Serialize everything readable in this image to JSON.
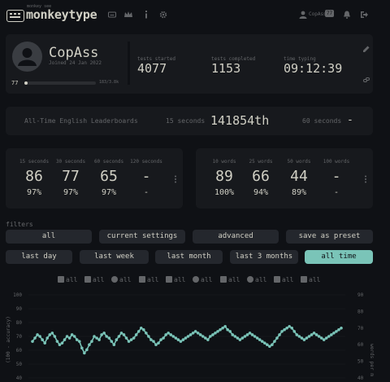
{
  "header": {
    "logo_sub": "monkey see",
    "logo_text": "monkeytype",
    "username": "CopAss",
    "user_level": "77"
  },
  "profile": {
    "name": "CopAss",
    "joined": "Joined 24 Jan 2022",
    "level": "77",
    "xp": "183/3.8k",
    "xp_progress": 0.05,
    "stats": [
      {
        "label": "tests started",
        "value": "4077"
      },
      {
        "label": "tests completed",
        "value": "1153"
      },
      {
        "label": "time typing",
        "value": "09:12:39"
      }
    ]
  },
  "leaderboard": {
    "title": "All-Time English Leaderboards",
    "items": [
      {
        "label": "15 seconds",
        "value": "141854th"
      },
      {
        "label": "60 seconds",
        "value": "-"
      }
    ]
  },
  "pbs_time": [
    {
      "label": "15 seconds",
      "wpm": "86",
      "acc": "97%"
    },
    {
      "label": "30 seconds",
      "wpm": "77",
      "acc": "97%"
    },
    {
      "label": "60 seconds",
      "wpm": "65",
      "acc": "97%"
    },
    {
      "label": "120 seconds",
      "wpm": "-",
      "acc": "-"
    }
  ],
  "pbs_words": [
    {
      "label": "10 words",
      "wpm": "89",
      "acc": "100%"
    },
    {
      "label": "25 words",
      "wpm": "66",
      "acc": "94%"
    },
    {
      "label": "50 words",
      "wpm": "44",
      "acc": "89%"
    },
    {
      "label": "100 words",
      "wpm": "-",
      "acc": "-"
    }
  ],
  "filters": {
    "title": "filters",
    "row1": [
      "all",
      "current settings",
      "advanced",
      "save as preset"
    ],
    "row2": [
      "last day",
      "last week",
      "last month",
      "last 3 months",
      "all time"
    ],
    "active": "all time",
    "chips": [
      "all",
      "all",
      "all",
      "all",
      "all",
      "all",
      "all",
      "all",
      "all",
      "all"
    ],
    "chip_icons": [
      "calendar-icon",
      "list-icon",
      "clock-icon",
      "font-icon",
      "star-icon",
      "at-icon",
      "hashtag-icon",
      "globe-icon",
      "gamepad-icon",
      "tag-icon"
    ]
  },
  "chart_data": {
    "type": "scatter",
    "ylabel_left": "(100 - accuracy)",
    "ylabel_right": "words per m",
    "yticks_left": [
      "100",
      "90",
      "80",
      "70",
      "60",
      "50",
      "40"
    ],
    "yticks_right": [
      "90",
      "80",
      "70",
      "60",
      "50",
      "40"
    ],
    "series": [
      {
        "name": "wpm",
        "values": [
          62,
          64,
          66,
          65,
          63,
          61,
          64,
          66,
          67,
          65,
          62,
          60,
          61,
          63,
          65,
          64,
          66,
          65,
          63,
          62,
          58,
          55,
          57,
          60,
          62,
          65,
          64,
          63,
          66,
          67,
          65,
          64,
          62,
          60,
          63,
          65,
          67,
          66,
          64,
          62,
          63,
          64,
          66,
          68,
          70,
          69,
          67,
          65,
          63,
          62,
          60,
          61,
          63,
          64,
          66,
          67,
          66,
          65,
          64,
          63,
          62,
          63,
          64,
          65,
          66,
          67,
          68,
          67,
          66,
          65,
          64,
          63,
          65,
          66,
          67,
          68,
          69,
          70,
          71,
          69,
          68,
          66,
          65,
          64,
          63,
          64,
          65,
          66,
          67,
          66,
          65,
          64,
          63,
          62,
          61,
          60,
          59,
          60,
          62,
          64,
          66,
          68,
          69,
          70,
          71,
          70,
          68,
          66,
          65,
          64,
          63,
          64,
          65,
          66,
          67,
          66,
          65,
          64,
          63,
          64,
          65,
          66,
          67,
          68,
          69,
          70
        ]
      }
    ],
    "color": "#7ac4b8"
  }
}
